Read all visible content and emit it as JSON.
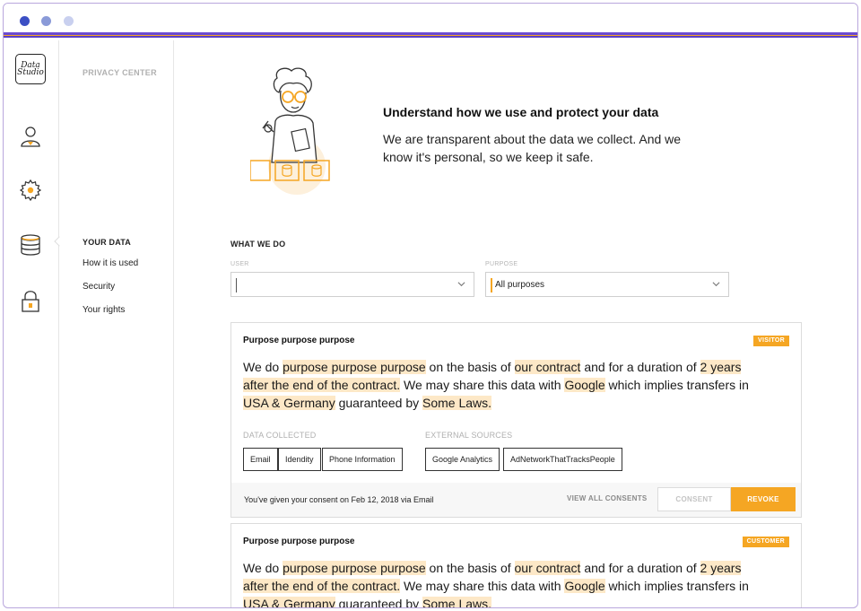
{
  "window": {
    "controls": [
      "close",
      "minimize",
      "maximize"
    ]
  },
  "rail": {
    "logo_text": "Data Studio",
    "icons": [
      "user-icon",
      "gear-icon",
      "database-icon",
      "lock-icon"
    ]
  },
  "nav": {
    "title": "PRIVACY CENTER",
    "section": "YOUR DATA",
    "items": [
      {
        "label": "How it is used"
      },
      {
        "label": "Security"
      },
      {
        "label": "Your rights"
      }
    ]
  },
  "hero": {
    "title": "Understand how we use and protect your data",
    "text": "We are transparent about the data we collect. And we know it's personal, so we keep it safe."
  },
  "what_we_do": {
    "heading": "WHAT WE DO",
    "user_label": "USER",
    "user_value": "",
    "purpose_label": "PURPOSE",
    "purpose_value": "All purposes"
  },
  "cards": [
    {
      "title": "Purpose purpose purpose",
      "badge": "VISITOR",
      "text": {
        "t1": "We do ",
        "h1": "purpose purpose purpose",
        "t2": " on the basis of ",
        "h2": "our contract",
        "t3": " and for a duration of ",
        "h3": "2 years after the end of the contract.",
        "t4": " We may share this data with ",
        "h4": "Google",
        "t5": " which implies transfers in ",
        "h5": "USA & Germany",
        "t6": " guaranteed by ",
        "h6": "Some Laws."
      },
      "data_collected_label": "DATA COLLECTED",
      "data_collected": [
        "Email",
        "Idendity",
        "Phone Information"
      ],
      "external_sources_label": "EXTERNAL SOURCES",
      "external_sources": [
        "Google Analytics",
        "AdNetworkThatTracksPeople"
      ],
      "consent_text": "You've given your consent on Feb 12, 2018 via Email",
      "view_all": "VIEW ALL CONSENTS",
      "consent_button": "CONSENT",
      "revoke_button": "REVOKE"
    },
    {
      "title": "Purpose purpose purpose",
      "badge": "CUSTOMER",
      "text": {
        "t1": "We do ",
        "h1": "purpose purpose purpose",
        "t2": " on the basis of ",
        "h2": "our contract",
        "t3": " and for a duration of ",
        "h3": "2 years after the end of the contract.",
        "t4": " We may share this data with ",
        "h4": "Google",
        "t5": " which implies transfers in ",
        "h5": "USA & Germany",
        "t6": " guaranteed by ",
        "h6": "Some Laws."
      }
    }
  ],
  "colors": {
    "accent": "#f5a623",
    "highlight": "#fde8c7",
    "brand_purple": "#5b3fc4"
  }
}
